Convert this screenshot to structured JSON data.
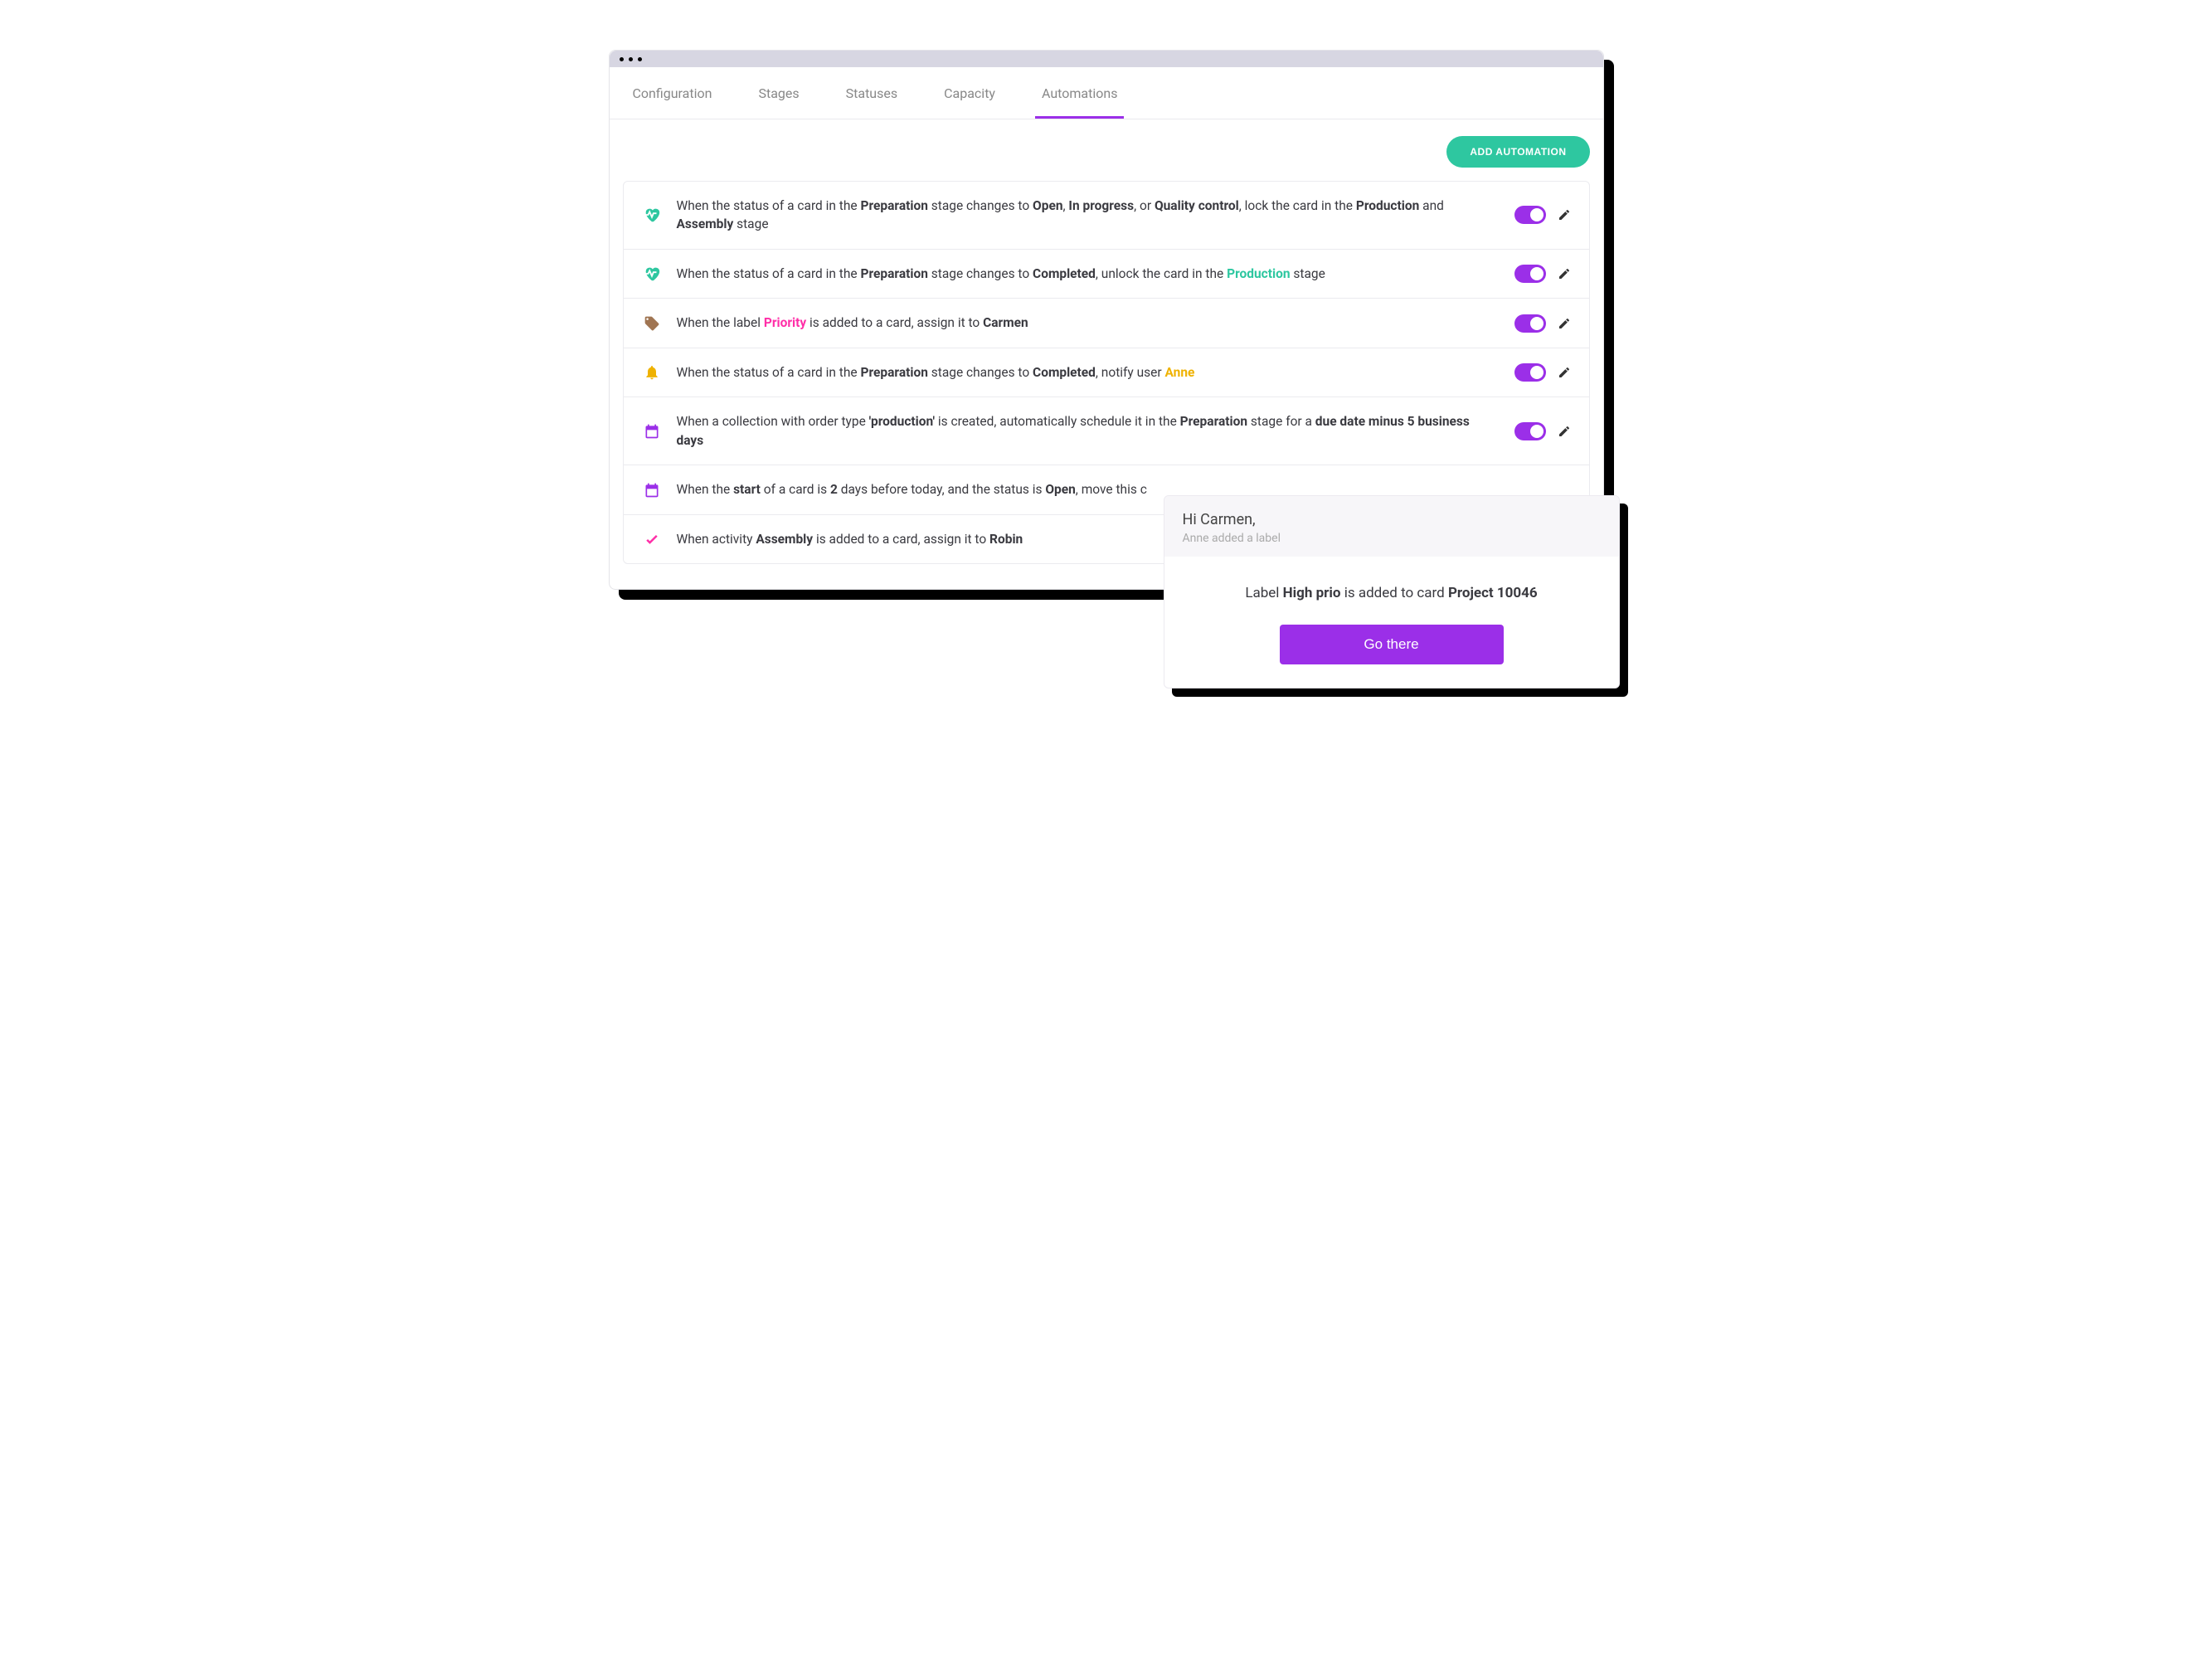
{
  "tabs": {
    "config": "Configuration",
    "stages": "Stages",
    "statuses": "Statuses",
    "capacity": "Capacity",
    "automations": "Automations"
  },
  "toolbar": {
    "add": "ADD AUTOMATION"
  },
  "rules": {
    "r1": {
      "t1": "When the status of a card in the ",
      "b1": "Preparation",
      "t2": " stage changes to ",
      "b2": "Open",
      "t3": ", ",
      "b3": "In progress",
      "t4": ", or ",
      "b4": "Quality control",
      "t5": ", lock the card in the ",
      "b5": "Production",
      "t6": " and ",
      "b6": "Assembly",
      "t7": " stage"
    },
    "r2": {
      "t1": "When the status of a card in the ",
      "b1": "Preparation",
      "t2": " stage changes to ",
      "b2": "Completed",
      "t3": ", unlock the card in the ",
      "c1": "Production",
      "t4": " stage"
    },
    "r3": {
      "t1": "When the label ",
      "c1": "Priority",
      "t2": " is added to a card, assign it to ",
      "b1": "Carmen"
    },
    "r4": {
      "t1": "When the status of a card in the ",
      "b1": "Preparation",
      "t2": " stage changes to ",
      "b2": "Completed",
      "t3": ", notify user ",
      "c1": "Anne"
    },
    "r5": {
      "t1": "When a collection with order type ",
      "b1": "'production'",
      "t2": " is created, automatically schedule it in the ",
      "b2": "Preparation",
      "t3": " stage for a ",
      "b3": "due date minus 5 business days"
    },
    "r6": {
      "t1": "When the ",
      "b1": "start",
      "t2": " of a card is ",
      "b2": "2",
      "t3": " days before today, and the status is ",
      "b3": "Open",
      "t4": ", move this c"
    },
    "r7": {
      "t1": "When activity ",
      "b1": "Assembly",
      "t2": " is added to a card, assign it to ",
      "b2": "Robin"
    }
  },
  "popup": {
    "greeting": "Hi Carmen,",
    "sub": "Anne added a label",
    "msg_t1": "Label ",
    "msg_b1": "High prio",
    "msg_t2": " is added to card ",
    "msg_b2": "Project 10046",
    "btn": "Go there"
  },
  "colors": {
    "accent": "#9b2fe8",
    "teal": "#2ec7a0",
    "pink": "#ff2fa8",
    "gold": "#efb200"
  }
}
